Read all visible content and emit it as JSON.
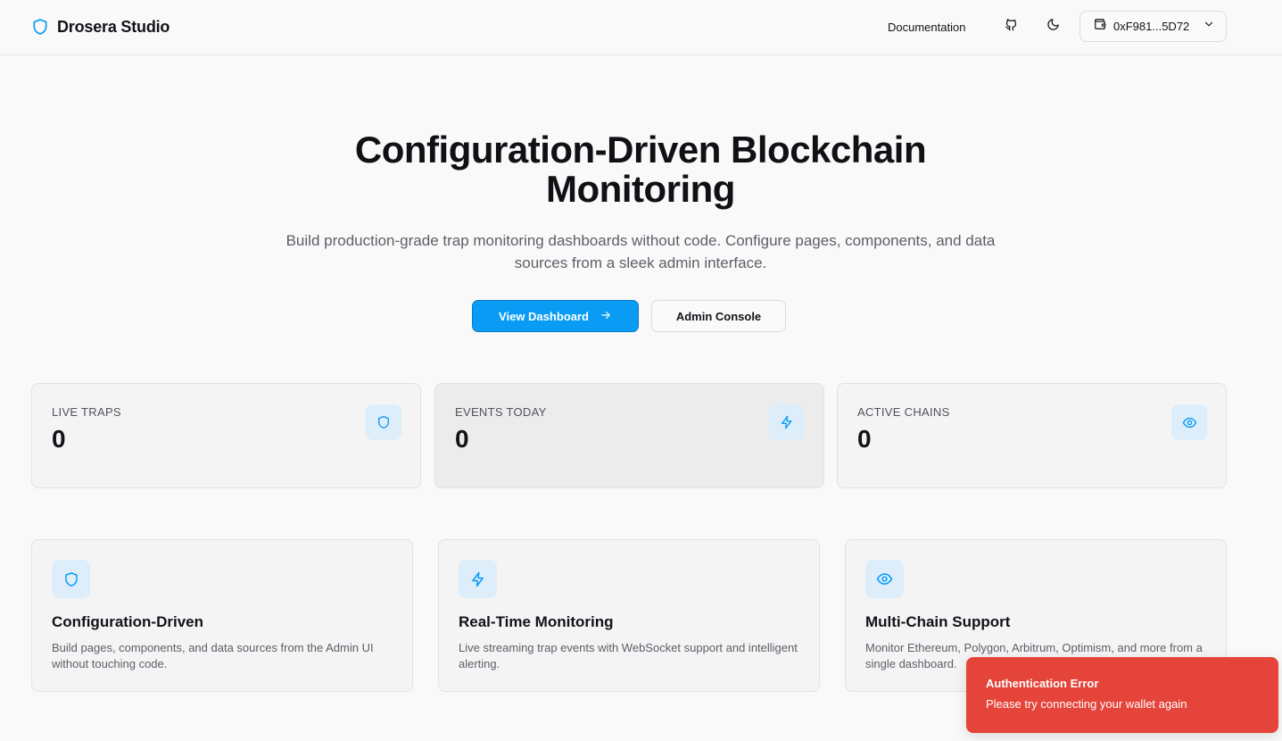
{
  "header": {
    "brand": "Drosera Studio",
    "documentation_label": "Documentation",
    "wallet_address": "0xF981...5D72"
  },
  "hero": {
    "title": "Configuration-Driven Blockchain Monitoring",
    "subtitle": "Build production-grade trap monitoring dashboards without code. Configure pages, components, and data sources from a sleek admin interface.",
    "primary_button": "View Dashboard",
    "secondary_button": "Admin Console"
  },
  "stats": [
    {
      "label": "LIVE TRAPS",
      "value": "0",
      "icon": "shield-icon"
    },
    {
      "label": "EVENTS TODAY",
      "value": "0",
      "icon": "lightning-icon"
    },
    {
      "label": "ACTIVE CHAINS",
      "value": "0",
      "icon": "eye-icon"
    }
  ],
  "features": [
    {
      "title": "Configuration-Driven",
      "description": "Build pages, components, and data sources from the Admin UI without touching code.",
      "icon": "shield-icon"
    },
    {
      "title": "Real-Time Monitoring",
      "description": "Live streaming trap events with WebSocket support and intelligent alerting.",
      "icon": "lightning-icon"
    },
    {
      "title": "Multi-Chain Support",
      "description": "Monitor Ethereum, Polygon, Arbitrum, Optimism, and more from a single dashboard.",
      "icon": "eye-icon"
    }
  ],
  "toast": {
    "title": "Authentication Error",
    "message": "Please try connecting your wallet again"
  },
  "colors": {
    "accent": "#0a9cf5",
    "icon_bg": "#ddeefa",
    "error": "#e5443a"
  }
}
